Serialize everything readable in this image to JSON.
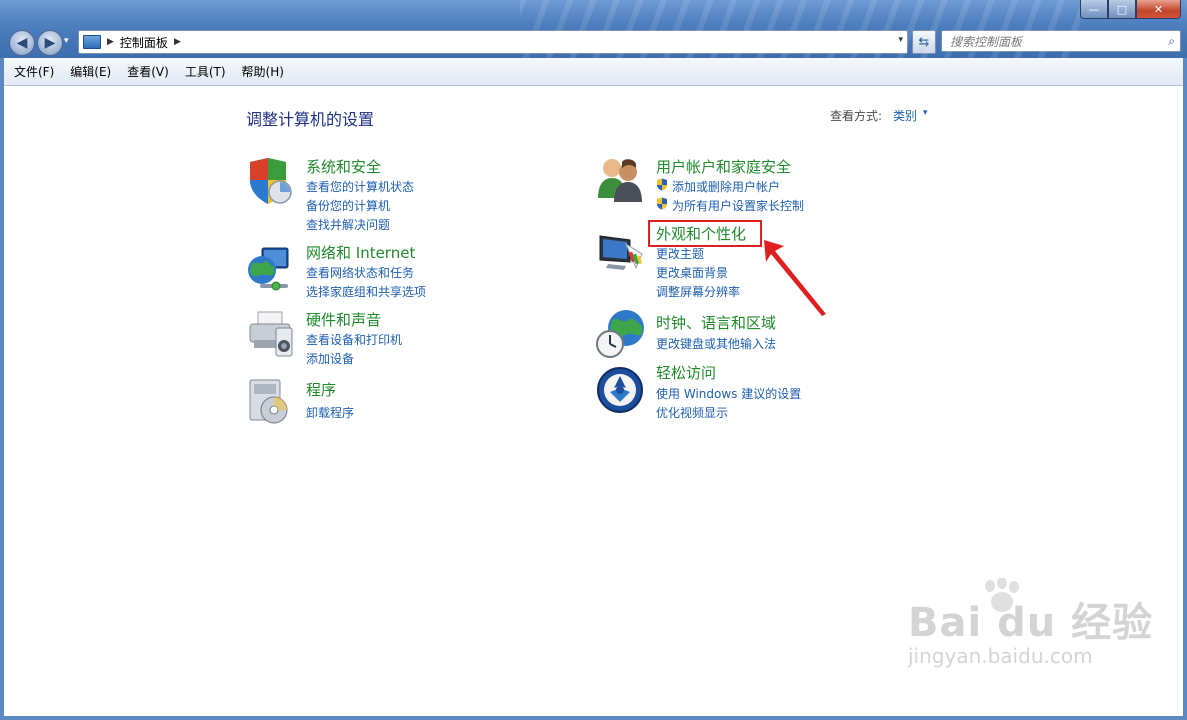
{
  "window": {
    "minimize": "—",
    "maximize": "□",
    "close": "✕"
  },
  "nav": {
    "back": "◀",
    "forward": "▶",
    "dropdown": "▾"
  },
  "address": {
    "separator": "▶",
    "crumb": "控制面板",
    "dropdown": "▾"
  },
  "search": {
    "placeholder": "搜索控制面板"
  },
  "menu": {
    "items": [
      "文件(F)",
      "编辑(E)",
      "查看(V)",
      "工具(T)",
      "帮助(H)"
    ]
  },
  "main": {
    "title": "调整计算机的设置",
    "view_by_label": "查看方式:",
    "view_by_value": "类别",
    "view_by_arrow": "▾"
  },
  "categories": {
    "left": [
      {
        "title": "系统和安全",
        "icon": "shield-icon",
        "links": [
          "查看您的计算机状态",
          "备份您的计算机",
          "查找并解决问题"
        ]
      },
      {
        "title": "网络和 Internet",
        "icon": "globe-network-icon",
        "links": [
          "查看网络状态和任务",
          "选择家庭组和共享选项"
        ]
      },
      {
        "title": "硬件和声音",
        "icon": "printer-icon",
        "links": [
          "查看设备和打印机",
          "添加设备"
        ]
      },
      {
        "title": "程序",
        "icon": "programs-icon",
        "links": [
          "卸载程序"
        ]
      }
    ],
    "right": [
      {
        "title": "用户帐户和家庭安全",
        "icon": "users-icon",
        "links": [
          "添加或删除用户帐户",
          "为所有用户设置家长控制"
        ]
      },
      {
        "title": "外观和个性化",
        "icon": "monitor-palette-icon",
        "links": [
          "更改主题",
          "更改桌面背景",
          "调整屏幕分辨率"
        ]
      },
      {
        "title": "时钟、语言和区域",
        "icon": "clock-globe-icon",
        "links": [
          "更改键盘或其他输入法"
        ]
      },
      {
        "title": "轻松访问",
        "icon": "ease-of-access-icon",
        "links": [
          "使用 Windows 建议的设置",
          "优化视频显示"
        ]
      }
    ]
  },
  "annotation": {
    "color": "#e02020"
  },
  "watermark": {
    "brand": "Bai du 经验",
    "url": "jingyan.baidu.com"
  }
}
